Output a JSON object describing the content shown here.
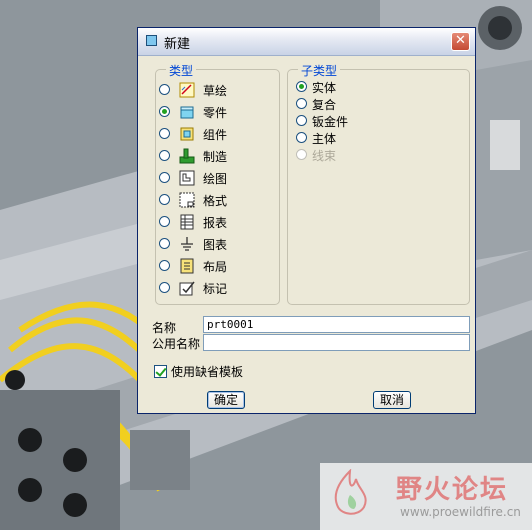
{
  "dialog": {
    "title": "新建",
    "close_symbol": "✕",
    "type_group": {
      "label": "类型",
      "items": [
        {
          "label": "草绘",
          "icon": "sketch-icon",
          "selected": false
        },
        {
          "label": "零件",
          "icon": "part-icon",
          "selected": true
        },
        {
          "label": "组件",
          "icon": "assembly-icon",
          "selected": false
        },
        {
          "label": "制造",
          "icon": "manufacturing-icon",
          "selected": false
        },
        {
          "label": "绘图",
          "icon": "drawing-icon",
          "selected": false
        },
        {
          "label": "格式",
          "icon": "format-icon",
          "selected": false
        },
        {
          "label": "报表",
          "icon": "report-icon",
          "selected": false
        },
        {
          "label": "图表",
          "icon": "diagram-icon",
          "selected": false
        },
        {
          "label": "布局",
          "icon": "layout-icon",
          "selected": false
        },
        {
          "label": "标记",
          "icon": "markup-icon",
          "selected": false
        }
      ]
    },
    "subtype_group": {
      "label": "子类型",
      "items": [
        {
          "label": "实体",
          "selected": true,
          "enabled": true
        },
        {
          "label": "复合",
          "selected": false,
          "enabled": true
        },
        {
          "label": "钣金件",
          "selected": false,
          "enabled": true
        },
        {
          "label": "主体",
          "selected": false,
          "enabled": true
        },
        {
          "label": "线束",
          "selected": false,
          "enabled": false
        }
      ]
    },
    "name_label": "名称",
    "name_value": "prt0001",
    "common_name_label": "公用名称",
    "common_name_value": "",
    "use_default_template_label": "使用缺省模板",
    "use_default_template_checked": true,
    "ok_label": "确定",
    "cancel_label": "取消"
  },
  "watermark": {
    "title": "野火论坛",
    "url": "www.proewildfire.cn"
  },
  "colors": {
    "group_label": "#0046d5",
    "radio_selected": "#21a121",
    "dialog_bg": "#ece9d8",
    "close_button": "#c44a33"
  }
}
